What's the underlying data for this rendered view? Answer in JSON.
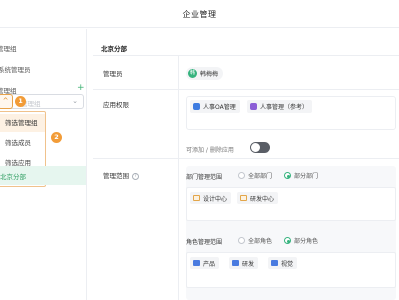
{
  "header": {
    "title": "企业管理"
  },
  "sidebar": {
    "text_group_admin_top": "管理组",
    "text_system_admin": "系统管理员",
    "text_group_admin": "管理组",
    "select_placeholder": "管理组",
    "badge_1": "1",
    "badge_2": "2",
    "menu_items": [
      "筛选管理组",
      "筛选成员",
      "筛选应用"
    ],
    "active_node": "北京分部"
  },
  "main": {
    "section_title": "北京分部",
    "admin": {
      "label": "管理员",
      "avatar_text": "韩",
      "name": "韩梅梅"
    },
    "permissions": {
      "label": "应用权限",
      "apps": [
        {
          "name": "人事OA管理",
          "color": "#3d7be0"
        },
        {
          "name": "人事管理（参考）",
          "color": "#8b5ed6"
        }
      ],
      "toggle_label": "可添加 / 删除应用",
      "toggle_on": true
    },
    "scope": {
      "label": "管理范围",
      "help_icon": "question-icon",
      "dept": {
        "label": "部门管理范围",
        "options": [
          "全部部门",
          "部分部门"
        ],
        "selected": "部分部门",
        "tags": [
          "设计中心",
          "研发中心"
        ]
      },
      "role": {
        "label": "角色管理范围",
        "options": [
          "全部角色",
          "部分角色"
        ],
        "selected": "部分角色",
        "tags": [
          "产品",
          "研发",
          "视觉"
        ]
      }
    }
  },
  "colors": {
    "accent": "#36b37e",
    "highlight": "#f29c38",
    "active_bg": "#e6f6ef"
  }
}
